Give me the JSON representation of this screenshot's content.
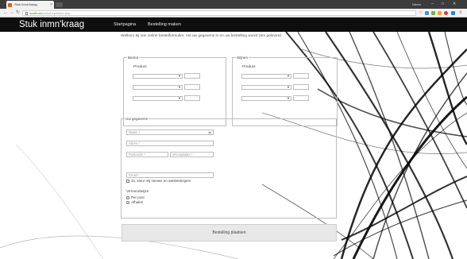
{
  "browser": {
    "tab_title": "Stuk Inmn'kraag",
    "profile_label": "Nieuw",
    "url_host": "localhost",
    "url_path": "/webshop/index.php",
    "window_controls": [
      "–",
      "□",
      "✕"
    ]
  },
  "site": {
    "brand": "Stuk inmn'kraag",
    "menu": [
      "Startpagina",
      "Bestelling maken"
    ]
  },
  "intro": "Welkom bij ons online bestelformulier. Vul uw gegevens in en uw bestelling wordt zsm geleverd.",
  "bieren": {
    "legend": "Bieren",
    "product_label": "Product",
    "rows": 3
  },
  "wijnen": {
    "legend": "Wijnen",
    "product_label": "Product",
    "rows": 3
  },
  "customer": {
    "legend": "Uw gegevens",
    "naam_placeholder": "Naam *",
    "adres_placeholder": "Adres *",
    "postcode_placeholder": "Postcode *",
    "woonplaats_placeholder": "Woonplaats *",
    "email_placeholder": "Email *",
    "newsletter_label": "Ja, stuur mij nieuws en aanbiedingen!"
  },
  "delivery": {
    "label": "Verzendwijze",
    "options": [
      "Per post",
      "Afhalen"
    ]
  },
  "submit_label": "Bestelling plaatsen",
  "colors": {
    "header_bg": "#0e0e0e",
    "page_bg": "#ffffff",
    "chrome_dark": "#3c3c3c",
    "chrome_light": "#f2f2f2"
  }
}
